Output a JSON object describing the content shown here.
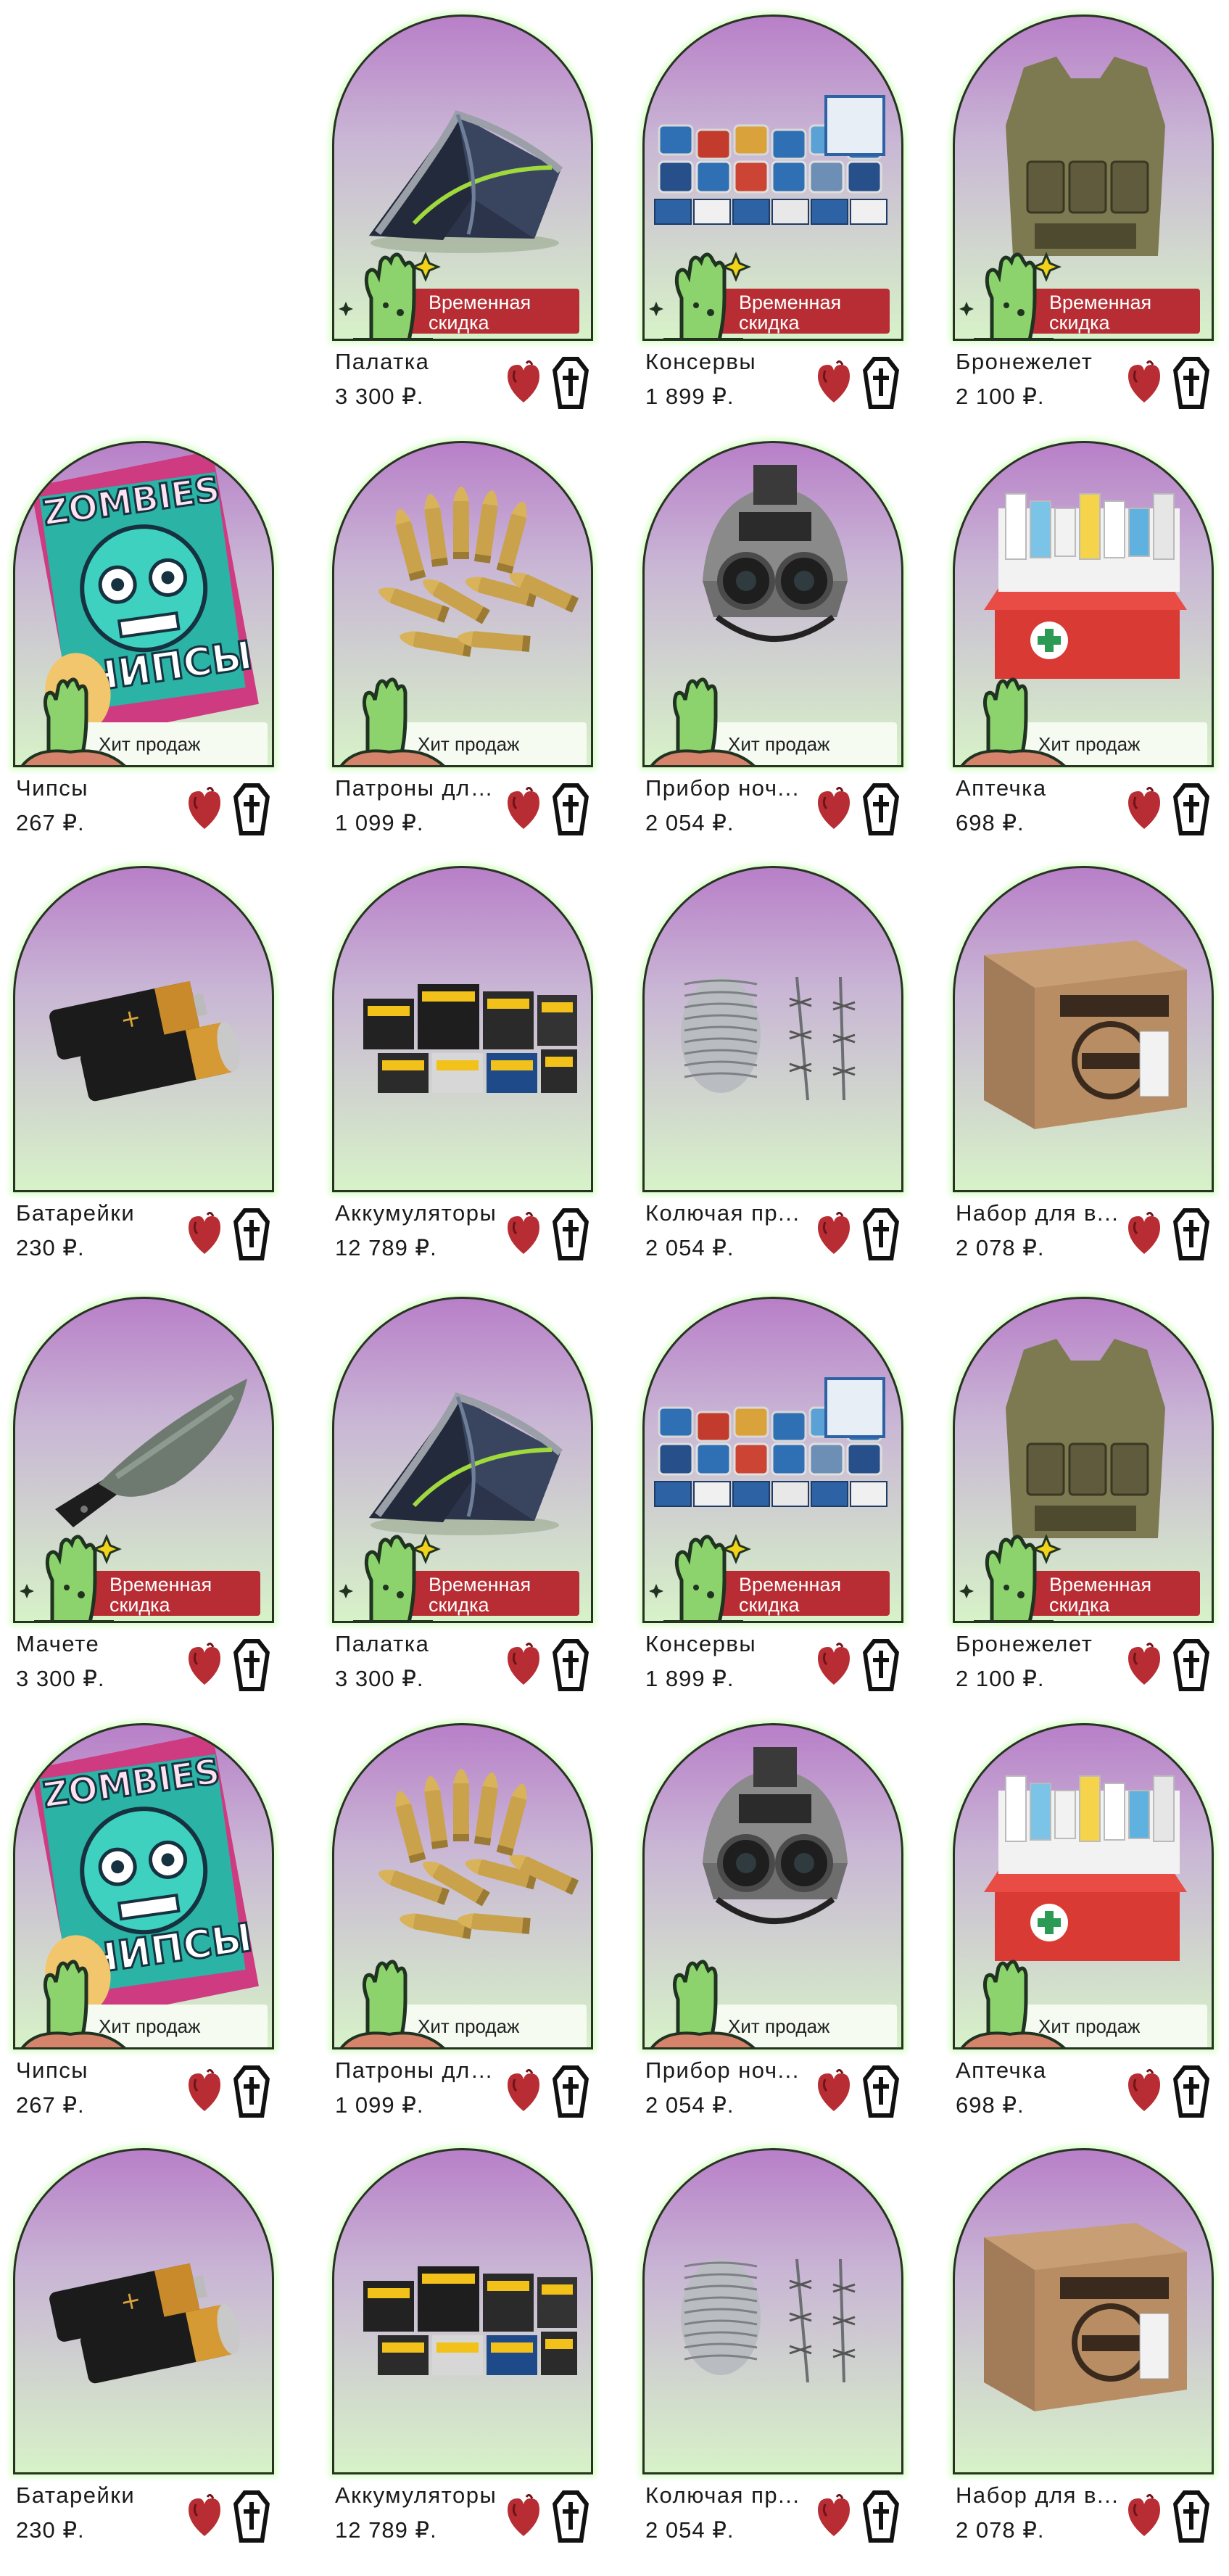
{
  "badges": {
    "sale": "Временная скидка",
    "hit": "Хит продаж"
  },
  "colors": {
    "arch_top": "#b87fc8",
    "arch_bottom": "#d7f2c8",
    "sale_badge": "#b72d33",
    "zombie_green": "#8cd36e",
    "heart": "#b72d33"
  },
  "icons": {
    "favorite": "heart-icon",
    "cart": "coffin-icon",
    "badge_sale": "zombie-hand-icon",
    "badge_hit": "zombie-hand-grave-icon"
  },
  "products": [
    {
      "name": "",
      "price": "",
      "badge": "none",
      "image": "empty"
    },
    {
      "name": "Палатка",
      "price": "3 300 ₽.",
      "badge": "sale",
      "image": "tent"
    },
    {
      "name": "Консервы",
      "price": "1 899 ₽.",
      "badge": "sale",
      "image": "cans"
    },
    {
      "name": "Бронежелет",
      "price": "2 100 ₽.",
      "badge": "sale",
      "image": "vest"
    },
    {
      "name": "Чипсы",
      "price": "267 ₽.",
      "badge": "hit",
      "image": "chips"
    },
    {
      "name": "Патроны для...",
      "price": "1 099 ₽.",
      "badge": "hit",
      "image": "bullets"
    },
    {
      "name": "Прибор ноч...",
      "price": "2 054 ₽.",
      "badge": "hit",
      "image": "nightvision"
    },
    {
      "name": "Аптечка",
      "price": "698 ₽.",
      "badge": "hit",
      "image": "firstaid"
    },
    {
      "name": "Батарейки",
      "price": "230 ₽.",
      "badge": "none",
      "image": "batteries"
    },
    {
      "name": "Аккумуляторы",
      "price": "12 789 ₽.",
      "badge": "none",
      "image": "accumulators"
    },
    {
      "name": "Колючая пр...",
      "price": "2 054 ₽.",
      "badge": "none",
      "image": "wire"
    },
    {
      "name": "Набор для в...",
      "price": "2 078 ₽.",
      "badge": "none",
      "image": "box"
    },
    {
      "name": "Мачете",
      "price": "3 300 ₽.",
      "badge": "sale",
      "image": "machete"
    },
    {
      "name": "Палатка",
      "price": "3 300 ₽.",
      "badge": "sale",
      "image": "tent"
    },
    {
      "name": "Консервы",
      "price": "1 899 ₽.",
      "badge": "sale",
      "image": "cans"
    },
    {
      "name": "Бронежелет",
      "price": "2 100 ₽.",
      "badge": "sale",
      "image": "vest"
    },
    {
      "name": "Чипсы",
      "price": "267 ₽.",
      "badge": "hit",
      "image": "chips"
    },
    {
      "name": "Патроны для...",
      "price": "1 099 ₽.",
      "badge": "hit",
      "image": "bullets"
    },
    {
      "name": "Прибор ноч...",
      "price": "2 054 ₽.",
      "badge": "hit",
      "image": "nightvision"
    },
    {
      "name": "Аптечка",
      "price": "698 ₽.",
      "badge": "hit",
      "image": "firstaid"
    },
    {
      "name": "Батарейки",
      "price": "230 ₽.",
      "badge": "none",
      "image": "batteries"
    },
    {
      "name": "Аккумуляторы",
      "price": "12 789 ₽.",
      "badge": "none",
      "image": "accumulators"
    },
    {
      "name": "Колючая пр...",
      "price": "2 054 ₽.",
      "badge": "none",
      "image": "wire"
    },
    {
      "name": "Набор для в...",
      "price": "2 078 ₽.",
      "badge": "none",
      "image": "box"
    }
  ]
}
